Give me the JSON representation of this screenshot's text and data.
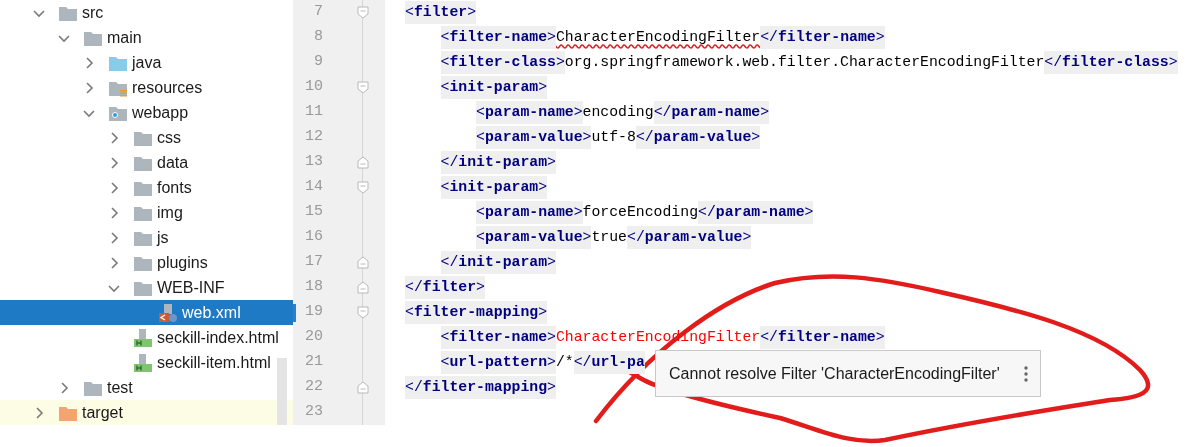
{
  "project_tree": [
    {
      "label": "src",
      "kind": "folder",
      "expanded": true,
      "selected": false,
      "children": [
        {
          "label": "main",
          "kind": "folder",
          "expanded": true,
          "selected": false,
          "children": [
            {
              "label": "java",
              "kind": "source-folder",
              "expanded": false,
              "selected": false
            },
            {
              "label": "resources",
              "kind": "resources-folder",
              "expanded": false,
              "selected": false
            },
            {
              "label": "webapp",
              "kind": "web-folder",
              "expanded": true,
              "selected": false,
              "children": [
                {
                  "label": "css",
                  "kind": "folder",
                  "expanded": false,
                  "selected": false
                },
                {
                  "label": "data",
                  "kind": "folder",
                  "expanded": false,
                  "selected": false
                },
                {
                  "label": "fonts",
                  "kind": "folder",
                  "expanded": false,
                  "selected": false
                },
                {
                  "label": "img",
                  "kind": "folder",
                  "expanded": false,
                  "selected": false
                },
                {
                  "label": "js",
                  "kind": "folder",
                  "expanded": false,
                  "selected": false
                },
                {
                  "label": "plugins",
                  "kind": "folder",
                  "expanded": false,
                  "selected": false
                },
                {
                  "label": "WEB-INF",
                  "kind": "folder",
                  "expanded": true,
                  "selected": false,
                  "children": [
                    {
                      "label": "web.xml",
                      "kind": "xml-file",
                      "selected": true
                    }
                  ]
                },
                {
                  "label": "seckill-index.html",
                  "kind": "html-file",
                  "selected": false
                },
                {
                  "label": "seckill-item.html",
                  "kind": "html-file",
                  "selected": false
                }
              ]
            }
          ]
        },
        {
          "label": "test",
          "kind": "folder",
          "expanded": false,
          "selected": false
        }
      ]
    },
    {
      "label": "target",
      "kind": "excluded-folder",
      "expanded": false,
      "selected": false
    }
  ],
  "editor": {
    "lines": [
      {
        "number": "7",
        "fold_open": true,
        "fold_close": false,
        "modified": false,
        "parts": [
          {
            "kind": "tag",
            "text": "<filter>"
          }
        ],
        "children": [
          {
            "number": "8",
            "fold_open": false,
            "fold_close": false,
            "modified": false,
            "parts": [
              {
                "kind": "tag",
                "text": "<filter-name>"
              },
              {
                "kind": "misspelled",
                "text": "CharacterEncodingFilter"
              },
              {
                "kind": "tag",
                "text": "</filter-name>"
              }
            ]
          },
          {
            "number": "9",
            "fold_open": false,
            "fold_close": false,
            "modified": false,
            "parts": [
              {
                "kind": "tag",
                "text": "<filter-class>"
              },
              {
                "kind": "text",
                "text": "org.springframework.web.filter.CharacterEncodingFilter"
              },
              {
                "kind": "tag",
                "text": "</filter-class>"
              }
            ]
          },
          {
            "number": "10",
            "fold_open": true,
            "fold_close": false,
            "modified": false,
            "parts": [
              {
                "kind": "tag",
                "text": "<init-param>"
              }
            ],
            "children": [
              {
                "number": "11",
                "fold_open": false,
                "fold_close": false,
                "modified": false,
                "parts": [
                  {
                    "kind": "tag",
                    "text": "<param-name>"
                  },
                  {
                    "kind": "text",
                    "text": "encoding"
                  },
                  {
                    "kind": "tag",
                    "text": "</param-name>"
                  }
                ]
              },
              {
                "number": "12",
                "fold_open": false,
                "fold_close": false,
                "modified": false,
                "parts": [
                  {
                    "kind": "tag",
                    "text": "<param-value>"
                  },
                  {
                    "kind": "text",
                    "text": "utf-8"
                  },
                  {
                    "kind": "tag",
                    "text": "</param-value>"
                  }
                ]
              }
            ]
          },
          {
            "number": "13",
            "fold_open": false,
            "fold_close": true,
            "modified": false,
            "parts": [
              {
                "kind": "tag",
                "text": "</init-param>"
              }
            ]
          },
          {
            "number": "14",
            "fold_open": true,
            "fold_close": false,
            "modified": false,
            "parts": [
              {
                "kind": "tag",
                "text": "<init-param>"
              }
            ],
            "children": [
              {
                "number": "15",
                "fold_open": false,
                "fold_close": false,
                "modified": false,
                "parts": [
                  {
                    "kind": "tag",
                    "text": "<param-name>"
                  },
                  {
                    "kind": "text",
                    "text": "forceEncoding"
                  },
                  {
                    "kind": "tag",
                    "text": "</param-name>"
                  }
                ]
              },
              {
                "number": "16",
                "fold_open": false,
                "fold_close": false,
                "modified": false,
                "parts": [
                  {
                    "kind": "tag",
                    "text": "<param-value>"
                  },
                  {
                    "kind": "text",
                    "text": "true"
                  },
                  {
                    "kind": "tag",
                    "text": "</param-value>"
                  }
                ]
              }
            ]
          },
          {
            "number": "17",
            "fold_open": false,
            "fold_close": true,
            "modified": false,
            "parts": [
              {
                "kind": "tag",
                "text": "</init-param>"
              }
            ]
          }
        ]
      },
      {
        "number": "18",
        "fold_open": false,
        "fold_close": true,
        "modified": false,
        "parts": [
          {
            "kind": "tag",
            "text": "</filter>"
          }
        ]
      },
      {
        "number": "19",
        "fold_open": true,
        "fold_close": false,
        "modified": true,
        "parts": [
          {
            "kind": "tag",
            "text": "<filter-mapping>"
          }
        ],
        "children": [
          {
            "number": "20",
            "fold_open": false,
            "fold_close": false,
            "modified": false,
            "parts": [
              {
                "kind": "tag",
                "text": "<filter-name>"
              },
              {
                "kind": "unresolved",
                "text": "CharacterEncodingFilter"
              },
              {
                "kind": "tag",
                "text": "</filter-name>"
              }
            ]
          },
          {
            "number": "21",
            "fold_open": false,
            "fold_close": false,
            "modified": false,
            "parts": [
              {
                "kind": "tag",
                "text": "<url-pattern>"
              },
              {
                "kind": "text",
                "text": "/*"
              },
              {
                "kind": "tag",
                "text": "</url-pa"
              }
            ]
          }
        ]
      },
      {
        "number": "22",
        "fold_open": false,
        "fold_close": true,
        "modified": false,
        "parts": [
          {
            "kind": "tag",
            "text": "</filter-mapping>"
          }
        ]
      },
      {
        "number": "23",
        "fold_open": false,
        "fold_close": false,
        "modified": false
      }
    ]
  },
  "tooltip": {
    "message": "Cannot resolve Filter 'CharacterEncodingFilter'"
  }
}
